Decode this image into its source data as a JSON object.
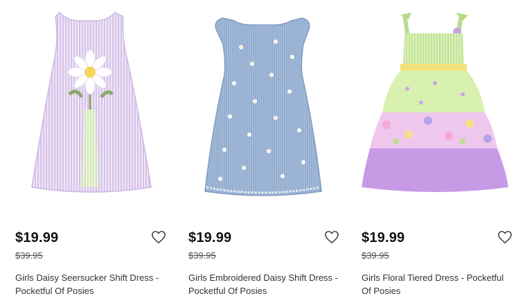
{
  "products": [
    {
      "image": "lavender-seersucker-shift-dress-daisy-appliqué",
      "price": "$19.99",
      "original_price": "$39.95",
      "name": "Girls Daisy Seersucker Shift Dress - Pocketful Of Posies",
      "wishlist_icon": "heart-outline-icon"
    },
    {
      "image": "chambray-shift-dress-embroidered-daisies",
      "price": "$19.99",
      "original_price": "$39.95",
      "name": "Girls Embroidered Daisy Shift Dress - Pocketful Of Posies",
      "wishlist_icon": "heart-outline-icon"
    },
    {
      "image": "green-purple-floral-tiered-dress",
      "price": "$19.99",
      "original_price": "$39.95",
      "name": "Girls Floral Tiered Dress - Pocketful Of Posies",
      "wishlist_icon": "heart-outline-icon"
    }
  ]
}
